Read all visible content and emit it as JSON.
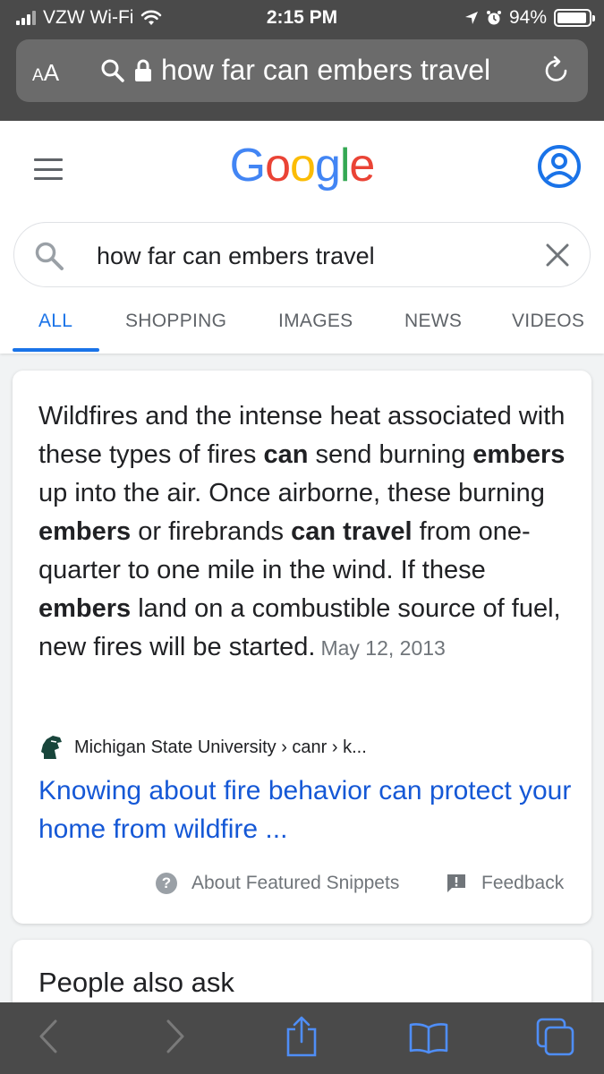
{
  "status_bar": {
    "carrier": "VZW Wi-Fi",
    "time": "2:15 PM",
    "battery_percent": "94%",
    "battery_level": 0.94
  },
  "browser": {
    "text_size_button": "AA",
    "address": "how far can embers travel"
  },
  "google": {
    "logo": "Google",
    "search_query": "how far can embers travel",
    "tabs": [
      "ALL",
      "SHOPPING",
      "IMAGES",
      "NEWS",
      "VIDEOS"
    ],
    "active_tab": "ALL"
  },
  "featured_snippet": {
    "segments": [
      {
        "text": "Wildfires and the intense heat associated with these types of fires ",
        "bold": false
      },
      {
        "text": "can",
        "bold": true
      },
      {
        "text": " send burning ",
        "bold": false
      },
      {
        "text": "embers",
        "bold": true
      },
      {
        "text": " up into the air. Once airborne, these burning ",
        "bold": false
      },
      {
        "text": "embers",
        "bold": true
      },
      {
        "text": " or firebrands ",
        "bold": false
      },
      {
        "text": "can travel",
        "bold": true
      },
      {
        "text": " from one-quarter to one mile in the wind. If these ",
        "bold": false
      },
      {
        "text": "embers",
        "bold": true
      },
      {
        "text": " land on a combustible source of fuel, new fires will be started.",
        "bold": false
      }
    ],
    "date": "May 12, 2013",
    "source": "Michigan State University › canr › k...",
    "title": "Knowing about fire behavior can protect your home from wildfire ...",
    "about_label": "About Featured Snippets",
    "feedback_label": "Feedback"
  },
  "people_also_ask": {
    "title": "People also ask"
  },
  "icons": [
    "signal-icon",
    "wifi-icon",
    "location-icon",
    "alarm-icon",
    "battery-icon",
    "search-icon",
    "lock-icon",
    "reload-icon",
    "menu-icon",
    "account-icon",
    "clear-icon",
    "msu-logo-icon",
    "help-icon",
    "feedback-icon",
    "back-icon",
    "forward-icon",
    "share-icon",
    "bookmarks-icon",
    "tabs-icon"
  ],
  "colors": {
    "link": "#1558d6",
    "active_tab": "#1a73e8",
    "google_blue": "#4285f4",
    "google_red": "#ea4335",
    "google_yellow": "#fbbc05",
    "google_green": "#34a853",
    "chrome": "#4a4a4a"
  }
}
